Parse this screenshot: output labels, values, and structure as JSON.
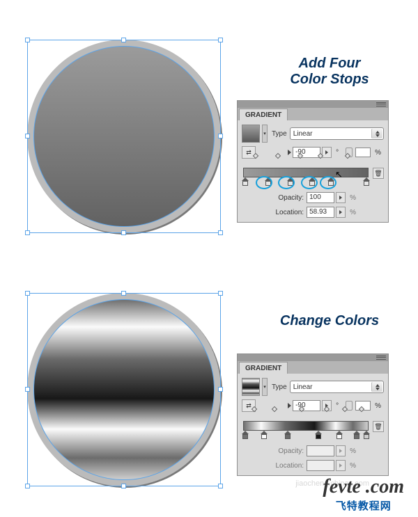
{
  "headings": {
    "top": "Add Four\nColor Stops",
    "bottom": "Change Colors"
  },
  "panel": {
    "title": "GRADIENT",
    "typeLabel": "Type",
    "typeValue": "Linear",
    "angle": "-90",
    "degree": "°",
    "percent": "%",
    "opacityLabel": "Opacity:",
    "locationLabel": "Location:"
  },
  "panel1": {
    "opacity": "100",
    "location": "58.93"
  },
  "panel2": {
    "opacity": "",
    "location": ""
  },
  "watermark": {
    "line1": "fevte .com",
    "line2": "飞特教程网"
  },
  "ghostText": "jiaocheng.chinaz.com",
  "chart_data": [
    {
      "type": "linear-gradient",
      "angle": -90,
      "title": "Add Four Color Stops",
      "stops_position_pct": [
        0,
        17,
        35,
        52,
        67,
        100
      ],
      "colors_hex": [
        "#9b9b9b",
        "#8e8e8e",
        "#838383",
        "#787878",
        "#707070",
        "#626262"
      ],
      "highlighted_added_stops_indices": [
        1,
        2,
        3,
        4
      ],
      "opacity_pct": 100,
      "selected_location_pct": 58.93
    },
    {
      "type": "linear-gradient",
      "angle": -90,
      "title": "Change Colors",
      "stops_position_pct": [
        0,
        14,
        33,
        57,
        74,
        88,
        100
      ],
      "colors_hex": [
        "#707070",
        "#fafafa",
        "#6a6a6a",
        "#181818",
        "#fafafa",
        "#6c6c6c",
        "#cecece"
      ]
    }
  ]
}
